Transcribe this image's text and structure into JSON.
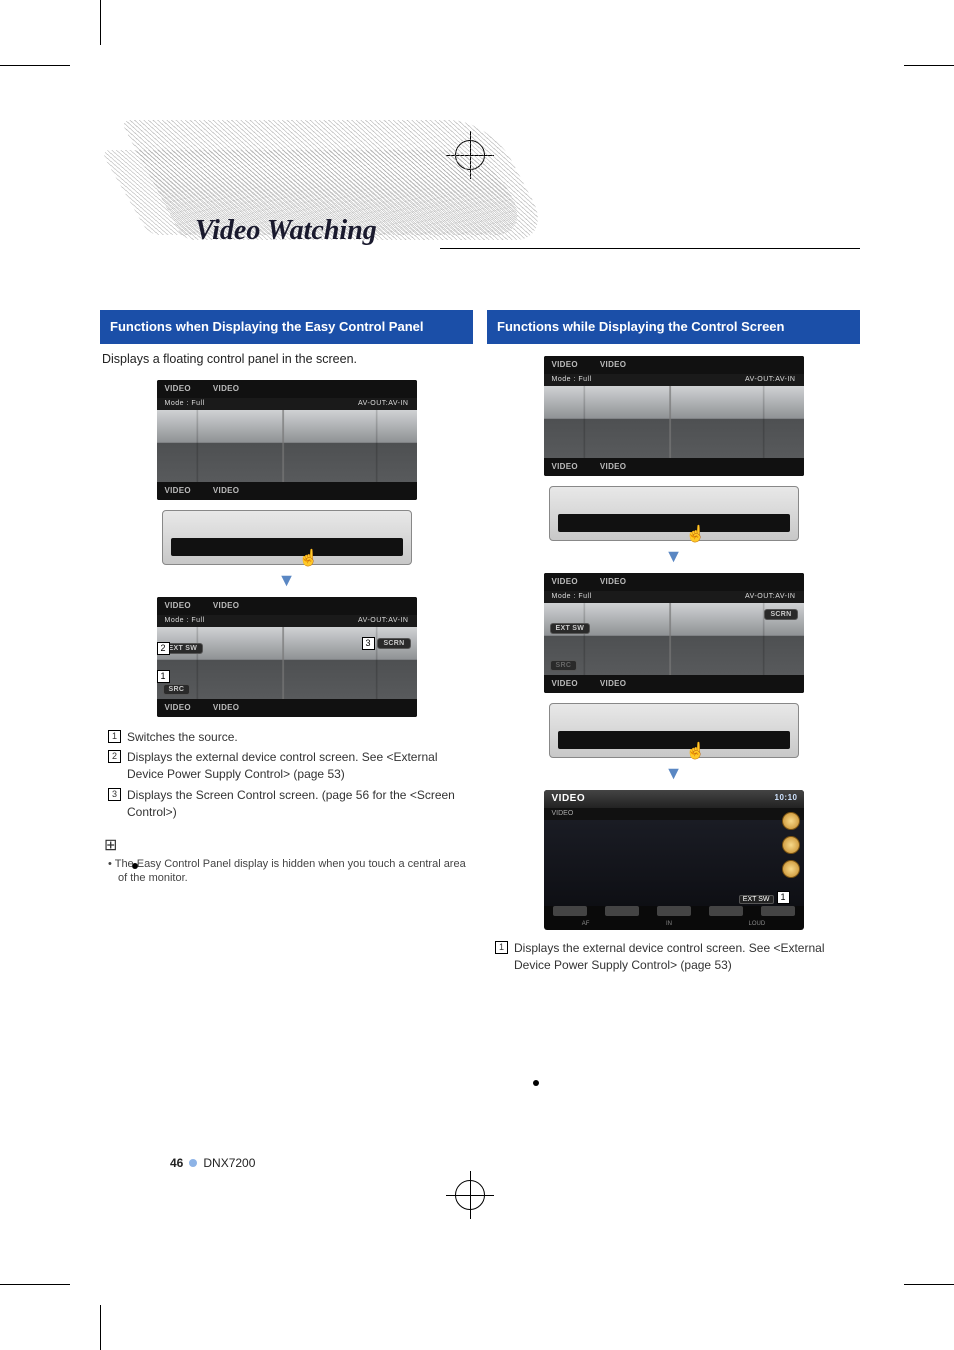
{
  "page_title": "Video Watching",
  "page_number": "46",
  "product_model": "DNX7200",
  "sections": {
    "left": {
      "heading": "Functions when Displaying the Easy Control Panel",
      "intro": "Displays a floating control panel in the screen.",
      "screen_labels": {
        "source_top_1": "VIDEO",
        "source_top_2": "VIDEO",
        "source_bot_1": "VIDEO",
        "source_bot_2": "VIDEO",
        "mode": "Mode : Full",
        "avout": "AV-OUT:AV-IN",
        "ext_sw": "EXT SW",
        "src": "SRC",
        "scrn": "SCRN"
      },
      "callouts": [
        {
          "n": "1",
          "text": "Switches the source."
        },
        {
          "n": "2",
          "text": "Displays the external device control screen. See <External Device Power Supply Control> (page 53)"
        },
        {
          "n": "3",
          "text": "Displays the Screen Control screen. (page 56 for the <Screen Control>)"
        }
      ],
      "note": "The Easy Control Panel display is hidden when you touch a central area of the monitor."
    },
    "right": {
      "heading": "Functions while Displaying the Control Screen",
      "screen_labels": {
        "source_top_1": "VIDEO",
        "source_top_2": "VIDEO",
        "source_bot_1": "VIDEO",
        "source_bot_2": "VIDEO",
        "mode": "Mode : Full",
        "avout": "AV-OUT:AV-IN",
        "scrn": "SCRN",
        "ext_sw": "EXT SW"
      },
      "control_screen": {
        "title": "VIDEO",
        "sub": "VIDEO",
        "time": "10:10",
        "ext_sw": "EXT SW",
        "footer": [
          "AF",
          "IN",
          "LOUD"
        ]
      },
      "callouts": [
        {
          "n": "1",
          "text": "Displays the external device control screen. See <External Device Power Supply Control> (page 53)"
        }
      ]
    }
  }
}
